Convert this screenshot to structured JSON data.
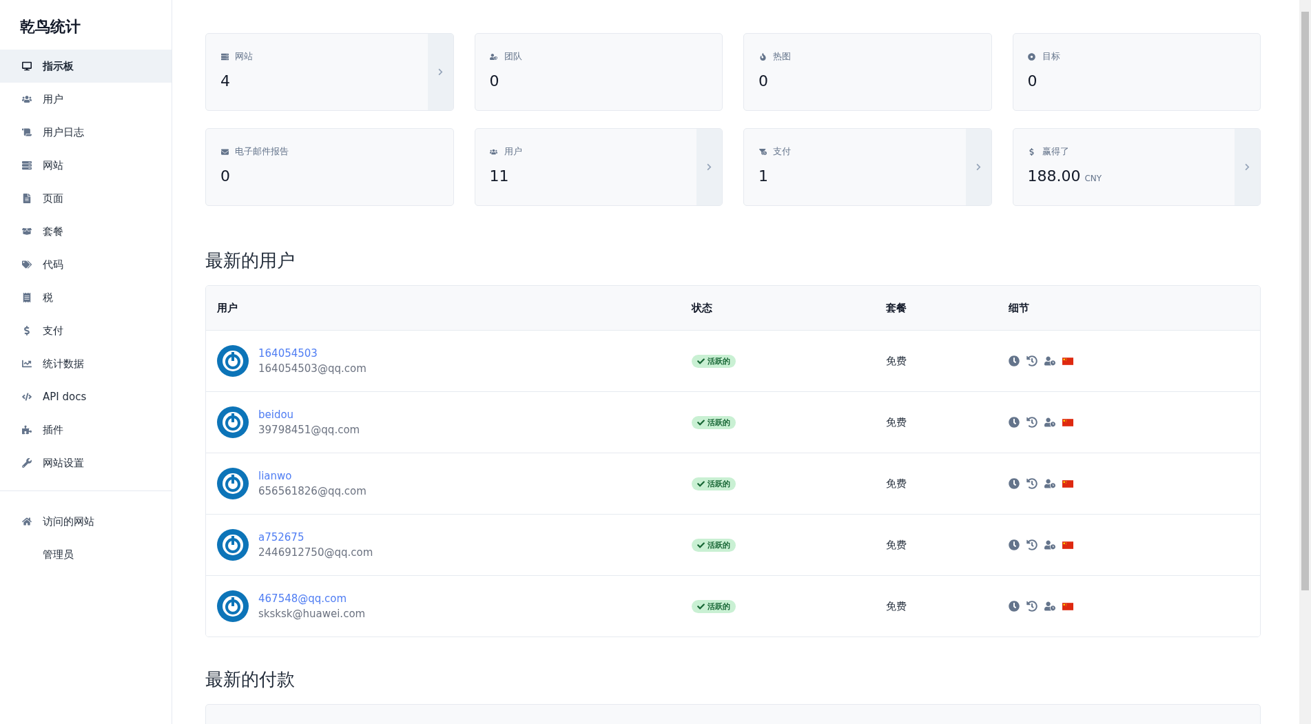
{
  "sidebar": {
    "brand": "乾鸟统计",
    "items": [
      {
        "kind": "dashboard",
        "label": "指示板",
        "selected": true
      },
      {
        "kind": "users",
        "label": "用户",
        "selected": false
      },
      {
        "kind": "logs",
        "label": "用户日志",
        "selected": false
      },
      {
        "kind": "websites",
        "label": "网站",
        "selected": false
      },
      {
        "kind": "pages",
        "label": "页面",
        "selected": false
      },
      {
        "kind": "plans",
        "label": "套餐",
        "selected": false
      },
      {
        "kind": "codes",
        "label": "代码",
        "selected": false
      },
      {
        "kind": "taxes",
        "label": "税",
        "selected": false
      },
      {
        "kind": "payments",
        "label": "支付",
        "selected": false
      },
      {
        "kind": "statistics",
        "label": "统计数据",
        "selected": false
      },
      {
        "kind": "api",
        "label": "API docs",
        "selected": false
      },
      {
        "kind": "plugins",
        "label": "插件",
        "selected": false
      },
      {
        "kind": "settings",
        "label": "网站设置",
        "selected": false
      }
    ],
    "footer_items": [
      {
        "kind": "home",
        "label": "访问的网站",
        "selected": false
      },
      {
        "kind": "none",
        "label": "管理员",
        "selected": false
      }
    ]
  },
  "stats": [
    {
      "kind": "websites",
      "label": "网站",
      "value": "4",
      "link": true
    },
    {
      "kind": "teams",
      "label": "团队",
      "value": "0",
      "link": false
    },
    {
      "kind": "heatmaps",
      "label": "热图",
      "value": "0",
      "link": false
    },
    {
      "kind": "goals",
      "label": "目标",
      "value": "0",
      "link": false
    },
    {
      "kind": "email",
      "label": "电子邮件报告",
      "value": "0",
      "link": false
    },
    {
      "kind": "users",
      "label": "用户",
      "value": "11",
      "link": true
    },
    {
      "kind": "payments",
      "label": "支付",
      "value": "1",
      "link": true
    },
    {
      "kind": "earned",
      "label": "赢得了",
      "value": "188.00",
      "unit": "CNY",
      "link": true
    }
  ],
  "latest_users": {
    "title": "最新的用户",
    "columns": [
      "用户",
      "状态",
      "套餐",
      "细节"
    ],
    "rows": [
      {
        "name": "164054503",
        "email": "164054503@qq.com",
        "status": "活跃的",
        "plan": "免费"
      },
      {
        "name": "beidou",
        "email": "39798451@qq.com",
        "status": "活跃的",
        "plan": "免费"
      },
      {
        "name": "lianwo",
        "email": "656561826@qq.com",
        "status": "活跃的",
        "plan": "免费"
      },
      {
        "name": "a752675",
        "email": "2446912750@qq.com",
        "status": "活跃的",
        "plan": "免费"
      },
      {
        "name": "467548@qq.com",
        "email": "sksksk@huawei.com",
        "status": "活跃的",
        "plan": "免费"
      }
    ]
  },
  "latest_payments": {
    "title": "最新的付款"
  }
}
